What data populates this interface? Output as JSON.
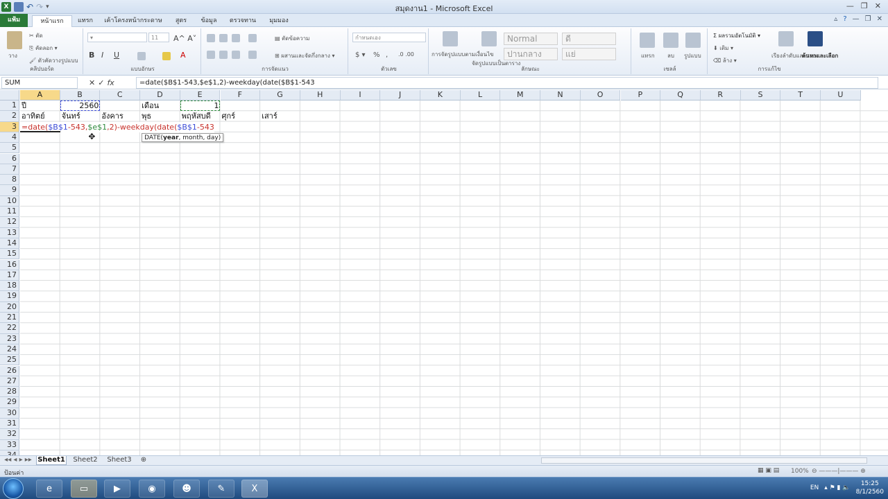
{
  "window": {
    "title": "สมุดงาน1 - Microsoft Excel"
  },
  "tabs": [
    "แฟ้ม",
    "หน้าแรก",
    "แทรก",
    "เค้าโครงหน้ากระดาษ",
    "สูตร",
    "ข้อมูล",
    "ตรวจทาน",
    "มุมมอง"
  ],
  "ribbon": {
    "clipboard": {
      "group": "คลิปบอร์ด",
      "paste": "วาง",
      "cut": "ตัด",
      "copy": "คัดลอก",
      "format_painter": "ตัวคัดวางรูปแบบ"
    },
    "font": {
      "group": "แบบอักษร",
      "size": "11"
    },
    "alignment": {
      "group": "การจัดแนว",
      "wrap": "ตัดข้อความ",
      "merge": "ผสานและจัดกึ่งกลาง"
    },
    "number": {
      "group": "ตัวเลข",
      "format": "กำหนดเอง"
    },
    "styles": {
      "group": "ลักษณะ",
      "conditional": "การจัดรูปแบบตามเงื่อนไข",
      "table": "จัดรูปแบบเป็นตาราง",
      "normal": "Normal",
      "good": "ดี",
      "neutral": "ปานกลาง",
      "bad": "แย่"
    },
    "cells": {
      "group": "เซลล์",
      "insert": "แทรก",
      "delete": "ลบ",
      "format": "รูปแบบ"
    },
    "editing": {
      "group": "การแก้ไข",
      "autosum": "ผลรวมอัตโนมัติ",
      "fill": "เติม",
      "clear": "ล้าง",
      "sort": "เรียงลำดับและกรอง",
      "find": "ค้นหาและเลือก"
    }
  },
  "formula_bar": {
    "name_box": "SUM",
    "cancel": "✕",
    "enter": "✓",
    "fx": "fx",
    "formula": "=date($B$1-543,$e$1,2)-weekday(date($B$1-543"
  },
  "columns": [
    "A",
    "B",
    "C",
    "D",
    "E",
    "F",
    "G",
    "H",
    "I",
    "J",
    "K",
    "L",
    "M",
    "N",
    "O",
    "P",
    "Q",
    "R",
    "S",
    "T",
    "U"
  ],
  "rows": [
    "1",
    "2",
    "3",
    "4",
    "5",
    "6",
    "7",
    "8",
    "9",
    "10",
    "11",
    "12",
    "13",
    "14",
    "15",
    "16",
    "17",
    "18",
    "19",
    "20",
    "21",
    "22",
    "23",
    "24",
    "25",
    "26",
    "27",
    "28",
    "29",
    "30",
    "31",
    "32",
    "33",
    "34"
  ],
  "cells": {
    "A1": "ปี",
    "B1": "2560",
    "D1": "เดือน",
    "E1": "1",
    "A2": "อาทิตย์",
    "B2": "จันทร์",
    "C2": "อังคาร",
    "D2": "พุธ",
    "E2": "พฤหัสบดี",
    "F2": "ศุกร์",
    "G2": "เสาร์"
  },
  "editing_formula": {
    "p1": "=date(",
    "p2": "$B$1",
    "p3": "-543,",
    "p4": "$e$1",
    "p5": ",2)-weekday(date(",
    "p6": "$B$1",
    "p7": "-543"
  },
  "tooltip": {
    "pre": "DATE(",
    "bold": "year",
    "post": ", month, day)"
  },
  "sheets": [
    "Sheet1",
    "Sheet2",
    "Sheet3"
  ],
  "status": {
    "mode": "ป้อนค่า",
    "zoom": "100%"
  },
  "tray": {
    "lang": "EN",
    "time": "15:25",
    "date": "8/1/2560"
  },
  "colors": {
    "ref_blue": "#3b4bd6",
    "ref_green": "#2e8a3c",
    "formula_red": "#c8322c",
    "file_tab": "#2a7a38"
  }
}
